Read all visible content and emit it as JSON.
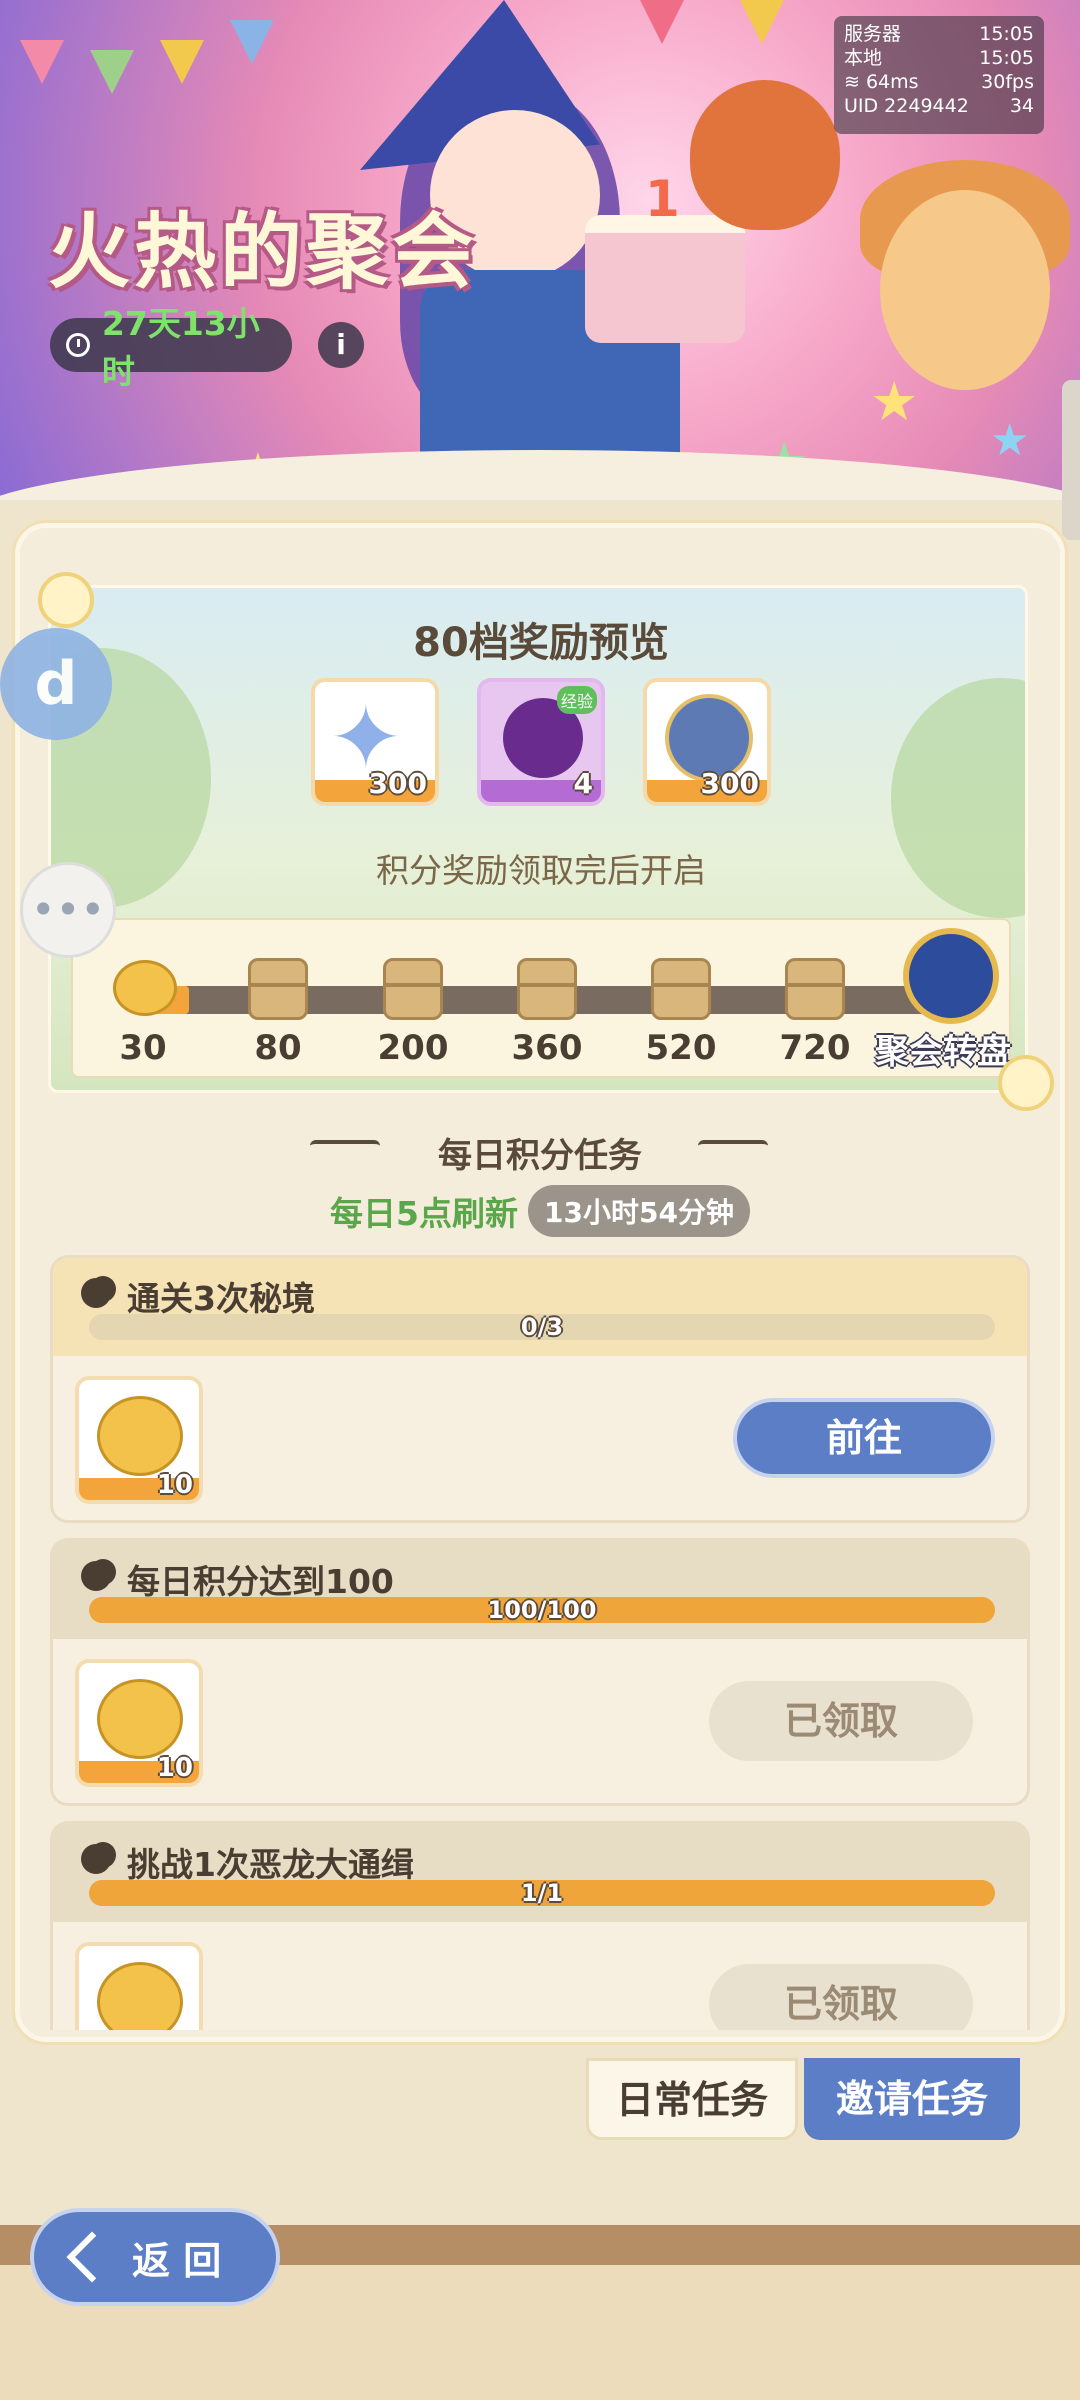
{
  "status": {
    "server_label": "服务器",
    "server_time": "15:05",
    "local_label": "本地",
    "local_time": "15:05",
    "ping": "64ms",
    "fps": "30fps",
    "uid": "UID 2249442",
    "battery": "34"
  },
  "event": {
    "title": "火热的聚会",
    "timer": "27天13小时",
    "info_glyph": "i"
  },
  "preview": {
    "title": "80档奖励预览",
    "rewards": [
      {
        "icon": "crystal-star-icon",
        "count": "300"
      },
      {
        "icon": "exp-orb-icon",
        "count": "4",
        "tag": "经验"
      },
      {
        "icon": "golden-arch-orb-icon",
        "count": "300"
      }
    ],
    "unlock_text": "积分奖励领取完后开启",
    "milestones": [
      "30",
      "80",
      "200",
      "360",
      "520",
      "720"
    ],
    "progress_fraction": 0.07,
    "wheel_label": "聚会转盘"
  },
  "daily": {
    "title": "每日积分任务",
    "refresh_label": "每日5点刷新",
    "refresh_time": "13小时54分钟"
  },
  "tasks": [
    {
      "name": "通关3次秘境",
      "progress": "0/3",
      "fraction": 0.0,
      "reward_count": "10",
      "button": "前往",
      "state": "go"
    },
    {
      "name": "每日积分达到100",
      "progress": "100/100",
      "fraction": 1.0,
      "reward_count": "10",
      "button": "已领取",
      "state": "claimed"
    },
    {
      "name": "挑战1次恶龙大通缉",
      "progress": "1/1",
      "fraction": 1.0,
      "reward_count": "",
      "button": "已领取",
      "state": "claimed"
    }
  ],
  "tabs": {
    "daily": "日常任务",
    "invite": "邀请任务"
  },
  "nav": {
    "back": "返 回"
  },
  "float": {
    "d_glyph": "d",
    "chat_glyph": "•••"
  }
}
